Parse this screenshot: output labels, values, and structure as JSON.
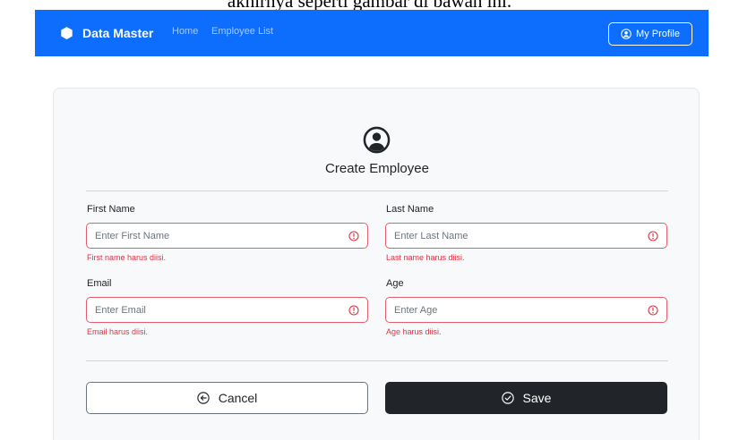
{
  "caption": "akhirnya seperti gambar di bawah ini.",
  "navbar": {
    "brand": "Data Master",
    "links": [
      "Home",
      "Employee List"
    ],
    "profile_label": "My Profile",
    "bg_color": "#0d6efd"
  },
  "form": {
    "title": "Create Employee",
    "fields": {
      "first_name": {
        "label": "First Name",
        "placeholder": "Enter First Name",
        "error": "First name harus diisi."
      },
      "last_name": {
        "label": "Last Name",
        "placeholder": "Enter Last Name",
        "error": "Last name harus diisi."
      },
      "email": {
        "label": "Email",
        "placeholder": "Enter Email",
        "error": "Email harus diisi."
      },
      "age": {
        "label": "Age",
        "placeholder": "Enter Age",
        "error": "Age harus diisi."
      }
    },
    "cancel_label": "Cancel",
    "save_label": "Save",
    "error_color": "#dc3545"
  },
  "icons": [
    "brand-hexagon-icon",
    "profile-icon",
    "user-circle-icon",
    "warning-icon",
    "back-arrow-icon",
    "check-circle-icon"
  ]
}
